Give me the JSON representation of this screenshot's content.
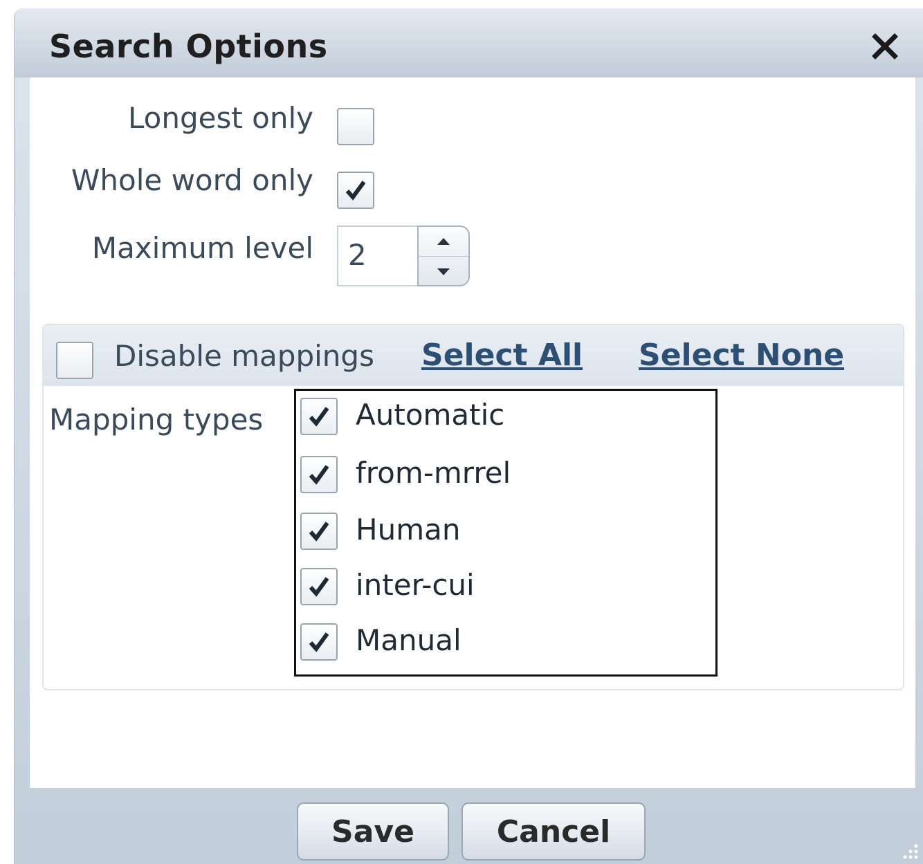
{
  "dialog": {
    "title": "Search Options",
    "close_icon": "close-icon"
  },
  "options": {
    "longest_only": {
      "label": "Longest only",
      "checked": false
    },
    "whole_word_only": {
      "label": "Whole word only",
      "checked": true
    },
    "maximum_level": {
      "label": "Maximum level",
      "value": "2"
    }
  },
  "mappings": {
    "disable_label": "Disable mappings",
    "disable_checked": false,
    "select_all": "Select All",
    "select_none": "Select None",
    "types_label": "Mapping types",
    "types": [
      {
        "label": "Automatic",
        "checked": true
      },
      {
        "label": "from-mrrel",
        "checked": true
      },
      {
        "label": "Human",
        "checked": true
      },
      {
        "label": "inter-cui",
        "checked": true
      },
      {
        "label": "Manual",
        "checked": true
      }
    ]
  },
  "footer": {
    "save_label": "Save",
    "cancel_label": "Cancel"
  },
  "colors": {
    "link": "#2e4f74",
    "titlebar": "#cfd8e2"
  }
}
